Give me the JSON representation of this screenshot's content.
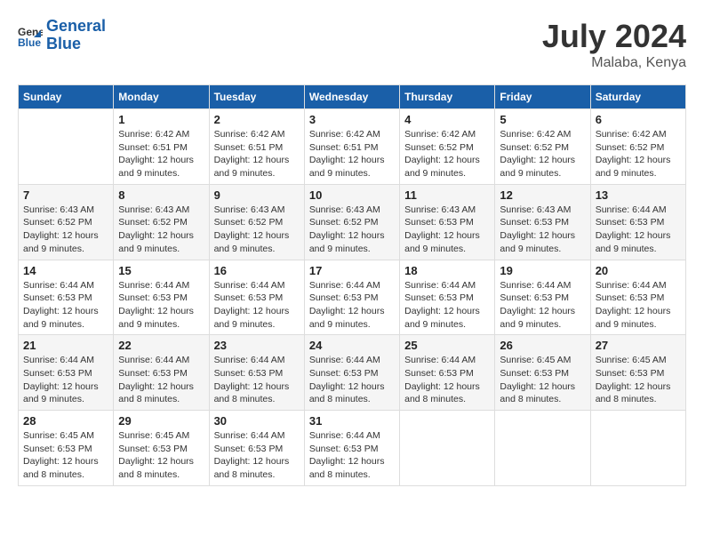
{
  "logo": {
    "line1": "General",
    "line2": "Blue"
  },
  "title": "July 2024",
  "subtitle": "Malaba, Kenya",
  "days_header": [
    "Sunday",
    "Monday",
    "Tuesday",
    "Wednesday",
    "Thursday",
    "Friday",
    "Saturday"
  ],
  "weeks": [
    [
      {
        "day": "",
        "info": ""
      },
      {
        "day": "1",
        "info": "Sunrise: 6:42 AM\nSunset: 6:51 PM\nDaylight: 12 hours\nand 9 minutes."
      },
      {
        "day": "2",
        "info": "Sunrise: 6:42 AM\nSunset: 6:51 PM\nDaylight: 12 hours\nand 9 minutes."
      },
      {
        "day": "3",
        "info": "Sunrise: 6:42 AM\nSunset: 6:51 PM\nDaylight: 12 hours\nand 9 minutes."
      },
      {
        "day": "4",
        "info": "Sunrise: 6:42 AM\nSunset: 6:52 PM\nDaylight: 12 hours\nand 9 minutes."
      },
      {
        "day": "5",
        "info": "Sunrise: 6:42 AM\nSunset: 6:52 PM\nDaylight: 12 hours\nand 9 minutes."
      },
      {
        "day": "6",
        "info": "Sunrise: 6:42 AM\nSunset: 6:52 PM\nDaylight: 12 hours\nand 9 minutes."
      }
    ],
    [
      {
        "day": "7",
        "info": "Sunrise: 6:43 AM\nSunset: 6:52 PM\nDaylight: 12 hours\nand 9 minutes."
      },
      {
        "day": "8",
        "info": "Sunrise: 6:43 AM\nSunset: 6:52 PM\nDaylight: 12 hours\nand 9 minutes."
      },
      {
        "day": "9",
        "info": "Sunrise: 6:43 AM\nSunset: 6:52 PM\nDaylight: 12 hours\nand 9 minutes."
      },
      {
        "day": "10",
        "info": "Sunrise: 6:43 AM\nSunset: 6:52 PM\nDaylight: 12 hours\nand 9 minutes."
      },
      {
        "day": "11",
        "info": "Sunrise: 6:43 AM\nSunset: 6:53 PM\nDaylight: 12 hours\nand 9 minutes."
      },
      {
        "day": "12",
        "info": "Sunrise: 6:43 AM\nSunset: 6:53 PM\nDaylight: 12 hours\nand 9 minutes."
      },
      {
        "day": "13",
        "info": "Sunrise: 6:44 AM\nSunset: 6:53 PM\nDaylight: 12 hours\nand 9 minutes."
      }
    ],
    [
      {
        "day": "14",
        "info": "Sunrise: 6:44 AM\nSunset: 6:53 PM\nDaylight: 12 hours\nand 9 minutes."
      },
      {
        "day": "15",
        "info": "Sunrise: 6:44 AM\nSunset: 6:53 PM\nDaylight: 12 hours\nand 9 minutes."
      },
      {
        "day": "16",
        "info": "Sunrise: 6:44 AM\nSunset: 6:53 PM\nDaylight: 12 hours\nand 9 minutes."
      },
      {
        "day": "17",
        "info": "Sunrise: 6:44 AM\nSunset: 6:53 PM\nDaylight: 12 hours\nand 9 minutes."
      },
      {
        "day": "18",
        "info": "Sunrise: 6:44 AM\nSunset: 6:53 PM\nDaylight: 12 hours\nand 9 minutes."
      },
      {
        "day": "19",
        "info": "Sunrise: 6:44 AM\nSunset: 6:53 PM\nDaylight: 12 hours\nand 9 minutes."
      },
      {
        "day": "20",
        "info": "Sunrise: 6:44 AM\nSunset: 6:53 PM\nDaylight: 12 hours\nand 9 minutes."
      }
    ],
    [
      {
        "day": "21",
        "info": "Sunrise: 6:44 AM\nSunset: 6:53 PM\nDaylight: 12 hours\nand 9 minutes."
      },
      {
        "day": "22",
        "info": "Sunrise: 6:44 AM\nSunset: 6:53 PM\nDaylight: 12 hours\nand 8 minutes."
      },
      {
        "day": "23",
        "info": "Sunrise: 6:44 AM\nSunset: 6:53 PM\nDaylight: 12 hours\nand 8 minutes."
      },
      {
        "day": "24",
        "info": "Sunrise: 6:44 AM\nSunset: 6:53 PM\nDaylight: 12 hours\nand 8 minutes."
      },
      {
        "day": "25",
        "info": "Sunrise: 6:44 AM\nSunset: 6:53 PM\nDaylight: 12 hours\nand 8 minutes."
      },
      {
        "day": "26",
        "info": "Sunrise: 6:45 AM\nSunset: 6:53 PM\nDaylight: 12 hours\nand 8 minutes."
      },
      {
        "day": "27",
        "info": "Sunrise: 6:45 AM\nSunset: 6:53 PM\nDaylight: 12 hours\nand 8 minutes."
      }
    ],
    [
      {
        "day": "28",
        "info": "Sunrise: 6:45 AM\nSunset: 6:53 PM\nDaylight: 12 hours\nand 8 minutes."
      },
      {
        "day": "29",
        "info": "Sunrise: 6:45 AM\nSunset: 6:53 PM\nDaylight: 12 hours\nand 8 minutes."
      },
      {
        "day": "30",
        "info": "Sunrise: 6:44 AM\nSunset: 6:53 PM\nDaylight: 12 hours\nand 8 minutes."
      },
      {
        "day": "31",
        "info": "Sunrise: 6:44 AM\nSunset: 6:53 PM\nDaylight: 12 hours\nand 8 minutes."
      },
      {
        "day": "",
        "info": ""
      },
      {
        "day": "",
        "info": ""
      },
      {
        "day": "",
        "info": ""
      }
    ]
  ]
}
